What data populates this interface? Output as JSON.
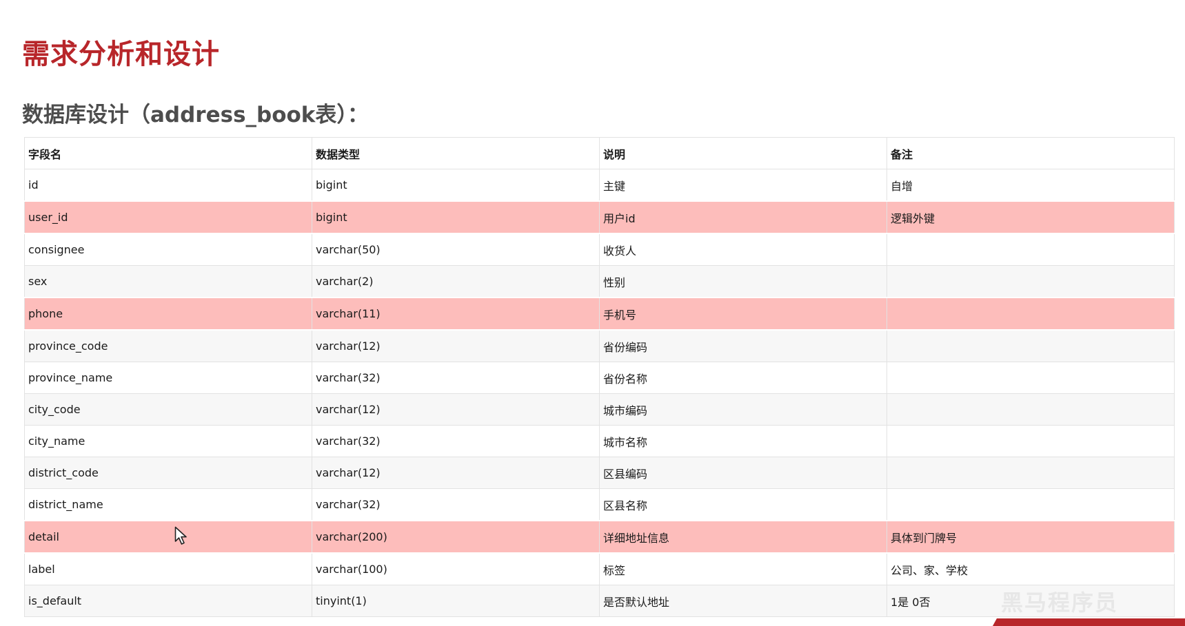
{
  "page": {
    "title": "需求分析和设计",
    "subtitle": "数据库设计（address_book表）："
  },
  "table": {
    "headers": [
      "字段名",
      "数据类型",
      "说明",
      "备注"
    ],
    "rows": [
      {
        "field": "id",
        "type": "bigint",
        "desc": "主键",
        "note": "自增",
        "highlight": false
      },
      {
        "field": "user_id",
        "type": "bigint",
        "desc": "用户id",
        "note": "逻辑外键",
        "highlight": true
      },
      {
        "field": "consignee",
        "type": "varchar(50)",
        "desc": "收货人",
        "note": "",
        "highlight": false
      },
      {
        "field": "sex",
        "type": "varchar(2)",
        "desc": "性别",
        "note": "",
        "highlight": false
      },
      {
        "field": "phone",
        "type": "varchar(11)",
        "desc": "手机号",
        "note": "",
        "highlight": true
      },
      {
        "field": "province_code",
        "type": "varchar(12)",
        "desc": "省份编码",
        "note": "",
        "highlight": false
      },
      {
        "field": "province_name",
        "type": "varchar(32)",
        "desc": "省份名称",
        "note": "",
        "highlight": false
      },
      {
        "field": "city_code",
        "type": "varchar(12)",
        "desc": "城市编码",
        "note": "",
        "highlight": false
      },
      {
        "field": "city_name",
        "type": "varchar(32)",
        "desc": "城市名称",
        "note": "",
        "highlight": false
      },
      {
        "field": "district_code",
        "type": "varchar(12)",
        "desc": "区县编码",
        "note": "",
        "highlight": false
      },
      {
        "field": "district_name",
        "type": "varchar(32)",
        "desc": "区县名称",
        "note": "",
        "highlight": false
      },
      {
        "field": "detail",
        "type": "varchar(200)",
        "desc": "详细地址信息",
        "note": "具体到门牌号",
        "highlight": true
      },
      {
        "field": "label",
        "type": "varchar(100)",
        "desc": "标签",
        "note": "公司、家、学校",
        "highlight": false
      },
      {
        "field": "is_default",
        "type": "tinyint(1)",
        "desc": "是否默认地址",
        "note": "1是 0否",
        "highlight": false
      }
    ]
  },
  "colors": {
    "title": "#b8262a",
    "highlight_row": "#fdbdbb",
    "alt_row": "#f7f7f7"
  },
  "watermark": {
    "text": "黑马程序员"
  },
  "icons": {
    "cursor": "mouse-pointer-icon"
  }
}
